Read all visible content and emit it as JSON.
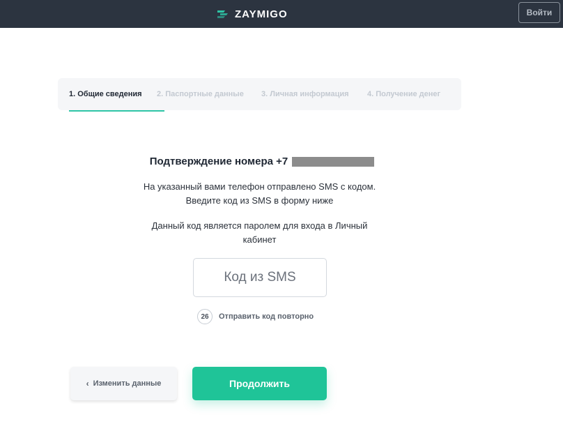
{
  "header": {
    "logo_text": "ZAYMIGO",
    "logo_icon": "zaymigo-logo-icon",
    "login_label": "Войти"
  },
  "steps": [
    {
      "label": "1. Общие сведения",
      "active": true
    },
    {
      "label": "2. Паспортные данные",
      "active": false
    },
    {
      "label": "3. Личная информация",
      "active": false
    },
    {
      "label": "4. Получение денег",
      "active": false
    }
  ],
  "confirm": {
    "title": "Подтверждение номера +7",
    "sms_info_line1": "На указанный вами телефон отправлено SMS с кодом.",
    "sms_info_line2": "Введите код из SMS в форму ниже",
    "password_info_line1": "Данный код является паролем для входа в Личный",
    "password_info_line2": "кабинет",
    "code_placeholder": "Код из SMS",
    "code_value": "",
    "timer": "26",
    "resend_label": "Отправить код повторно"
  },
  "actions": {
    "back_label": "Изменить данные",
    "continue_label": "Продолжить"
  },
  "colors": {
    "accent": "#1fc498",
    "header_bg": "#2c3440",
    "step_underline": "#2ec5a6"
  }
}
